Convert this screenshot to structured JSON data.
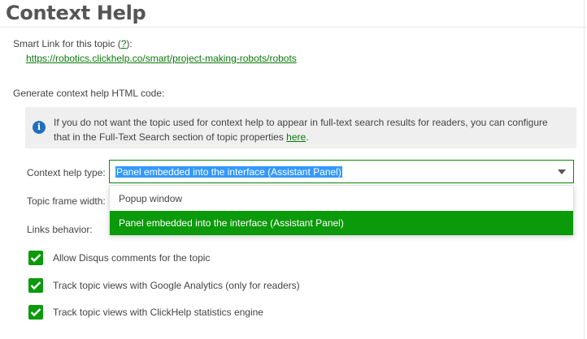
{
  "page": {
    "title": "Context Help"
  },
  "smart_link": {
    "label": "Smart Link for this topic (",
    "help_link": "?",
    "label_end": "):",
    "url": "https://robotics.clickhelp.co/smart/project-making-robots/robots"
  },
  "generate": {
    "label": "Generate context help HTML code:"
  },
  "info": {
    "icon": "info-icon",
    "text": "If you do not want the topic used for context help to appear in full-text search results for readers, you can configure that in the Full-Text Search section of topic properties ",
    "link": "here",
    "text_end": "."
  },
  "form": {
    "context_help_type_label": "Context help type:",
    "topic_frame_width_label": "Topic frame width:",
    "links_behavior_label": "Links behavior:",
    "selected_value": "Panel embedded into the interface (Assistant Panel)",
    "options": [
      "Popup window",
      "Panel embedded into the interface (Assistant Panel)"
    ]
  },
  "checkboxes": [
    {
      "label": "Allow Disqus comments for the topic",
      "checked": true
    },
    {
      "label": "Track topic views with Google Analytics (only for readers)",
      "checked": true
    },
    {
      "label": "Track topic views with ClickHelp statistics engine",
      "checked": true
    }
  ],
  "colors": {
    "accent": "#0a9a0a",
    "link": "#0a7a0a",
    "info_icon": "#1f6fbf",
    "selection": "#3399ff"
  }
}
